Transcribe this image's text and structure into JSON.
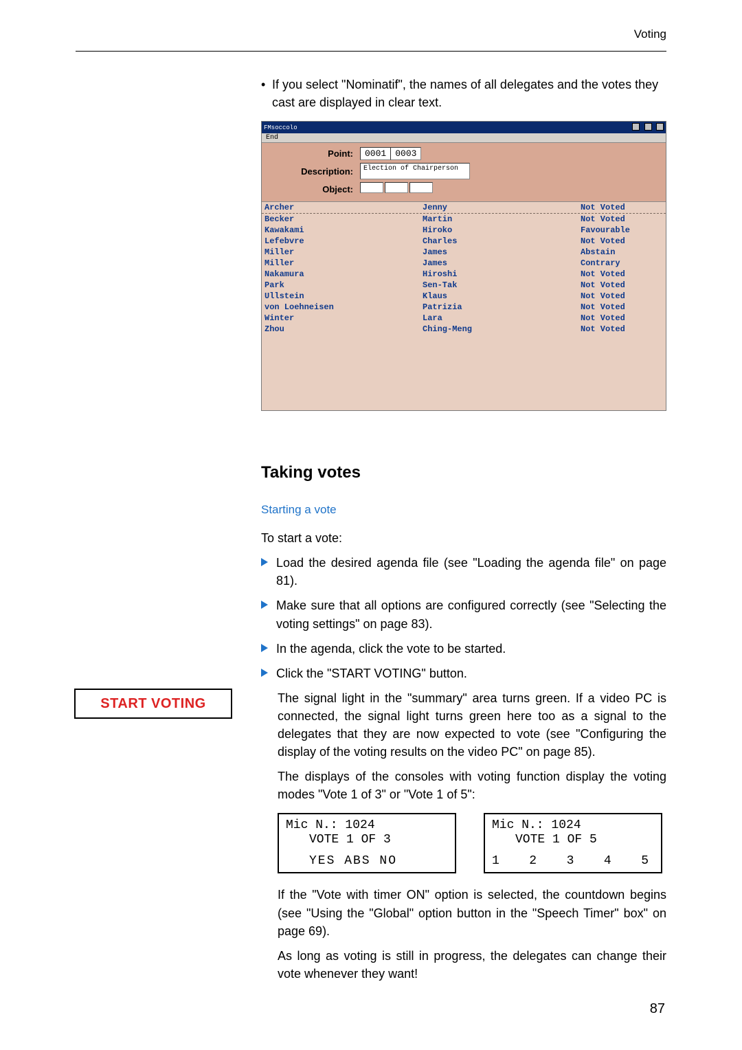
{
  "running_head": "Voting",
  "intro_bullet": "If you select \"Nominatif\", the names of all delegates and the votes they cast are displayed in clear text.",
  "window": {
    "title": "FMsoccolo",
    "menu": "End",
    "labels": {
      "point": "Point:",
      "description": "Description:",
      "object": "Object:"
    },
    "point_values": [
      "0001",
      "0003"
    ],
    "description_value": "Election of Chairperson",
    "rows": [
      {
        "last": "Archer",
        "first": "Jenny",
        "vote": "Not Voted"
      },
      {
        "last": "Becker",
        "first": "Martin",
        "vote": "Not Voted"
      },
      {
        "last": "Kawakami",
        "first": "Hiroko",
        "vote": "Favourable"
      },
      {
        "last": "Lefebvre",
        "first": "Charles",
        "vote": "Not Voted"
      },
      {
        "last": "Miller",
        "first": "James",
        "vote": "Abstain"
      },
      {
        "last": "Miller",
        "first": "James",
        "vote": "Contrary"
      },
      {
        "last": "Nakamura",
        "first": "Hiroshi",
        "vote": "Not Voted"
      },
      {
        "last": "Park",
        "first": "Sen-Tak",
        "vote": "Not Voted"
      },
      {
        "last": "Ullstein",
        "first": "Klaus",
        "vote": "Not Voted"
      },
      {
        "last": "von Loehneisen",
        "first": "Patrizia",
        "vote": "Not Voted"
      },
      {
        "last": "Winter",
        "first": "Lara",
        "vote": "Not Voted"
      },
      {
        "last": "Zhou",
        "first": "Ching-Meng",
        "vote": "Not Voted"
      }
    ]
  },
  "section_heading": "Taking votes",
  "sub_heading": "Starting a vote",
  "lead": "To start a vote:",
  "steps": [
    "Load the desired agenda file (see \"Loading the agenda file\" on page 81).",
    "Make sure that all options are configured correctly (see \"Selecting the voting settings\" on page 83).",
    "In the agenda, click the vote to be started.",
    "Click the \"START VOTING\" button."
  ],
  "start_button_label": "START VOTING",
  "after_button_para1": "The signal light in the \"summary\" area turns green. If a video PC is connected, the signal light turns green here too as a signal to the delegates that they are now expected to vote (see \"Configuring the display of the voting results on the video PC\" on page 85).",
  "after_button_para2": "The displays of the consoles with voting function display the voting modes \"Vote 1 of 3\" or \"Vote 1 of 5\":",
  "lcd1": {
    "l1": "Mic N.: 1024",
    "l2": "VOTE 1 OF 3",
    "l3": "YES  ABS  NO"
  },
  "lcd2": {
    "l1": "Mic N.: 1024",
    "l2": "VOTE 1 OF 5",
    "opts": [
      "1",
      "2",
      "3",
      "4",
      "5"
    ]
  },
  "tail_para1": "If the \"Vote with timer ON\" option is selected, the countdown begins (see \"Using the \"Global\" option button in the \"Speech Timer\" box\" on page 69).",
  "tail_para2": "As long as voting is still in progress, the delegates can change their vote whenever they want!",
  "page_number": "87"
}
